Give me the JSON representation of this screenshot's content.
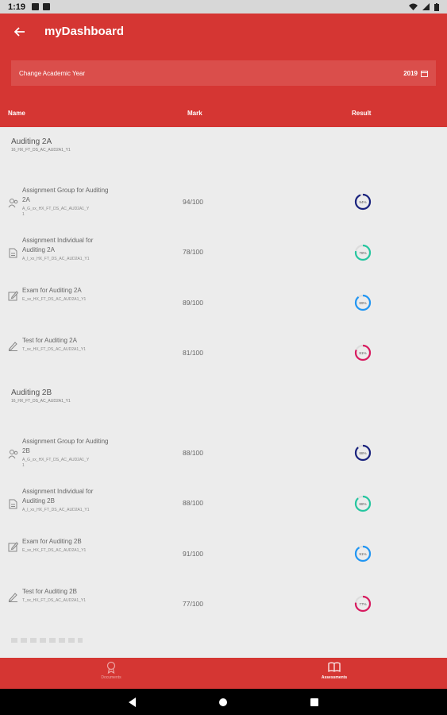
{
  "status": {
    "time": "1:19"
  },
  "app": {
    "title": "myDashboard"
  },
  "year": {
    "label": "Change Academic Year",
    "value": "2019"
  },
  "columns": {
    "name": "Name",
    "mark": "Mark",
    "result": "Result"
  },
  "groups": [
    {
      "title": "Auditing 2A",
      "code": "16_HX_FT_DS_AC_AUD2A1_Y1",
      "items": [
        {
          "name": "Assignment Group for Auditing 2A",
          "code": "A_G_xx_HX_FT_DS_AC_AUD2A1_Y",
          "code2": "1",
          "mark": "94/100",
          "percent": 94,
          "pct_label": "94%",
          "color": "#1a237e",
          "icon": "group-icon"
        },
        {
          "name": "Assignment Individual for Auditing 2A",
          "code": "A_I_xx_HX_FT_DS_AC_AUD2A1_Y1",
          "mark": "78/100",
          "percent": 78,
          "pct_label": "78%",
          "color": "#26c6a0",
          "icon": "document-icon"
        },
        {
          "name": "Exam for Auditing 2A",
          "code": "E_xx_HX_FT_DS_AC_AUD2A1_Y1",
          "mark": "89/100",
          "percent": 89,
          "pct_label": "89%",
          "color": "#2196f3",
          "icon": "edit-icon"
        },
        {
          "name": "Test for Auditing 2A",
          "code": "T_xx_HX_FT_DS_AC_AUD2A1_Y1",
          "mark": "81/100",
          "percent": 81,
          "pct_label": "81%",
          "color": "#d81b60",
          "icon": "pencil-icon"
        }
      ]
    },
    {
      "title": "Auditing 2B",
      "code": "16_HX_FT_DS_AC_AUD2A1_Y1",
      "items": [
        {
          "name": "Assignment Group for Auditing 2B",
          "code": "A_G_xx_HX_FT_DS_AC_AUD2A1_Y",
          "code2": "1",
          "mark": "88/100",
          "percent": 88,
          "pct_label": "88%",
          "color": "#1a237e",
          "icon": "group-icon"
        },
        {
          "name": "Assignment Individual for Auditing 2B",
          "code": "A_I_xx_HX_FT_DS_AC_AUD2A1_Y1",
          "mark": "88/100",
          "percent": 88,
          "pct_label": "88%",
          "color": "#26c6a0",
          "icon": "document-icon"
        },
        {
          "name": "Exam for Auditing 2B",
          "code": "E_xx_HX_FT_DS_AC_AUD2A1_Y1",
          "mark": "91/100",
          "percent": 91,
          "pct_label": "91%",
          "color": "#2196f3",
          "icon": "edit-icon"
        },
        {
          "name": "Test for Auditing 2B",
          "code": "T_xx_HX_FT_DS_AC_AUD2A1_Y1",
          "mark": "77/100",
          "percent": 77,
          "pct_label": "77%",
          "color": "#d81b60",
          "icon": "pencil-icon"
        }
      ]
    }
  ],
  "nav": {
    "documents": "Documents",
    "assessments": "Assessments"
  }
}
